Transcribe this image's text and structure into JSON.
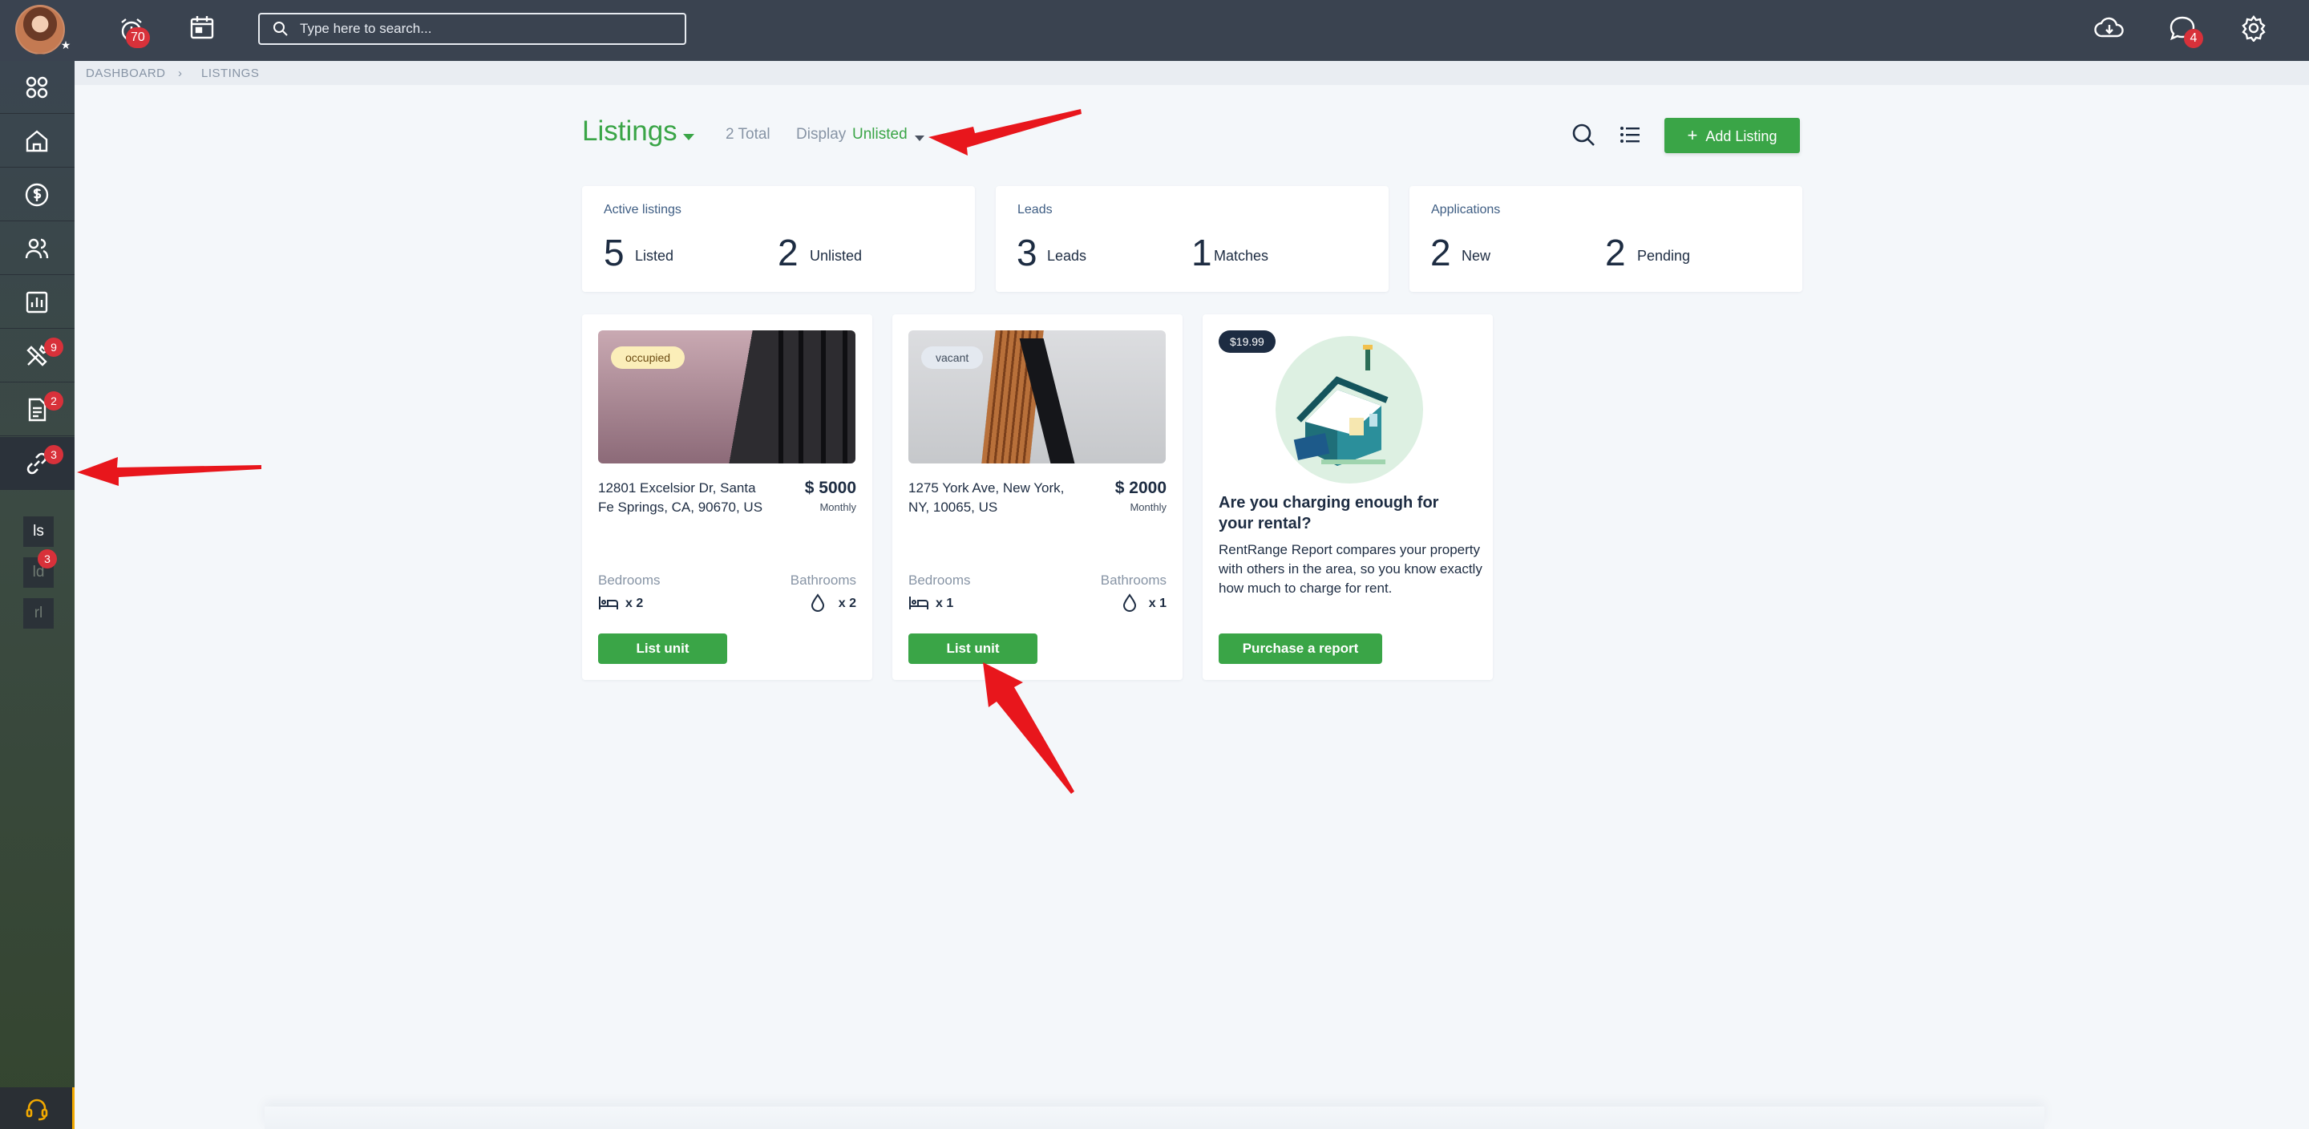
{
  "topbar": {
    "alerts_badge": "70",
    "search_placeholder": "Type here to search...",
    "messages_badge": "4"
  },
  "sidebar": {
    "maintenance_badge": "9",
    "documents_badge": "2",
    "links_badge": "3",
    "mini": [
      {
        "label": "ls",
        "badge": ""
      },
      {
        "label": "ld",
        "badge": "3"
      },
      {
        "label": "rl",
        "badge": ""
      }
    ]
  },
  "breadcrumb": {
    "items": [
      "DASHBOARD",
      "LISTINGS"
    ]
  },
  "header": {
    "title": "Listings",
    "total": "2 Total",
    "display_label": "Display",
    "display_value": "Unlisted",
    "add_button": "Add Listing"
  },
  "stats": [
    {
      "label": "Active listings",
      "a_num": "5",
      "a_word": "Listed",
      "b_num": "2",
      "b_word": "Unlisted"
    },
    {
      "label": "Leads",
      "a_num": "3",
      "a_word": "Leads",
      "b_num": "1",
      "b_word": "Matches"
    },
    {
      "label": "Applications",
      "a_num": "2",
      "a_word": "New",
      "b_num": "2",
      "b_word": "Pending"
    }
  ],
  "listings": [
    {
      "status": "occupied",
      "address": "12801 Excelsior Dr, Santa Fe Springs, CA, 90670, US",
      "price": "$ 5000",
      "period": "Monthly",
      "bedrooms_label": "Bedrooms",
      "bedrooms": "x 2",
      "bathrooms_label": "Bathrooms",
      "bathrooms": "x 2",
      "button": "List unit"
    },
    {
      "status": "vacant",
      "address": "1275 York Ave, New York, NY, 10065, US",
      "price": "$ 2000",
      "period": "Monthly",
      "bedrooms_label": "Bedrooms",
      "bedrooms": "x 1",
      "bathrooms_label": "Bathrooms",
      "bathrooms": "x 1",
      "button": "List unit"
    }
  ],
  "promo": {
    "price": "$19.99",
    "title": "Are you charging enough for your rental?",
    "body": "RentRange Report compares your property with others in the area, so you know exactly how much to charge for rent.",
    "button": "Purchase a report"
  },
  "colors": {
    "topbar": "#3a4350",
    "accent_green": "#3aa547",
    "badge_red": "#d8313a",
    "annotation_red": "#e8161c"
  }
}
